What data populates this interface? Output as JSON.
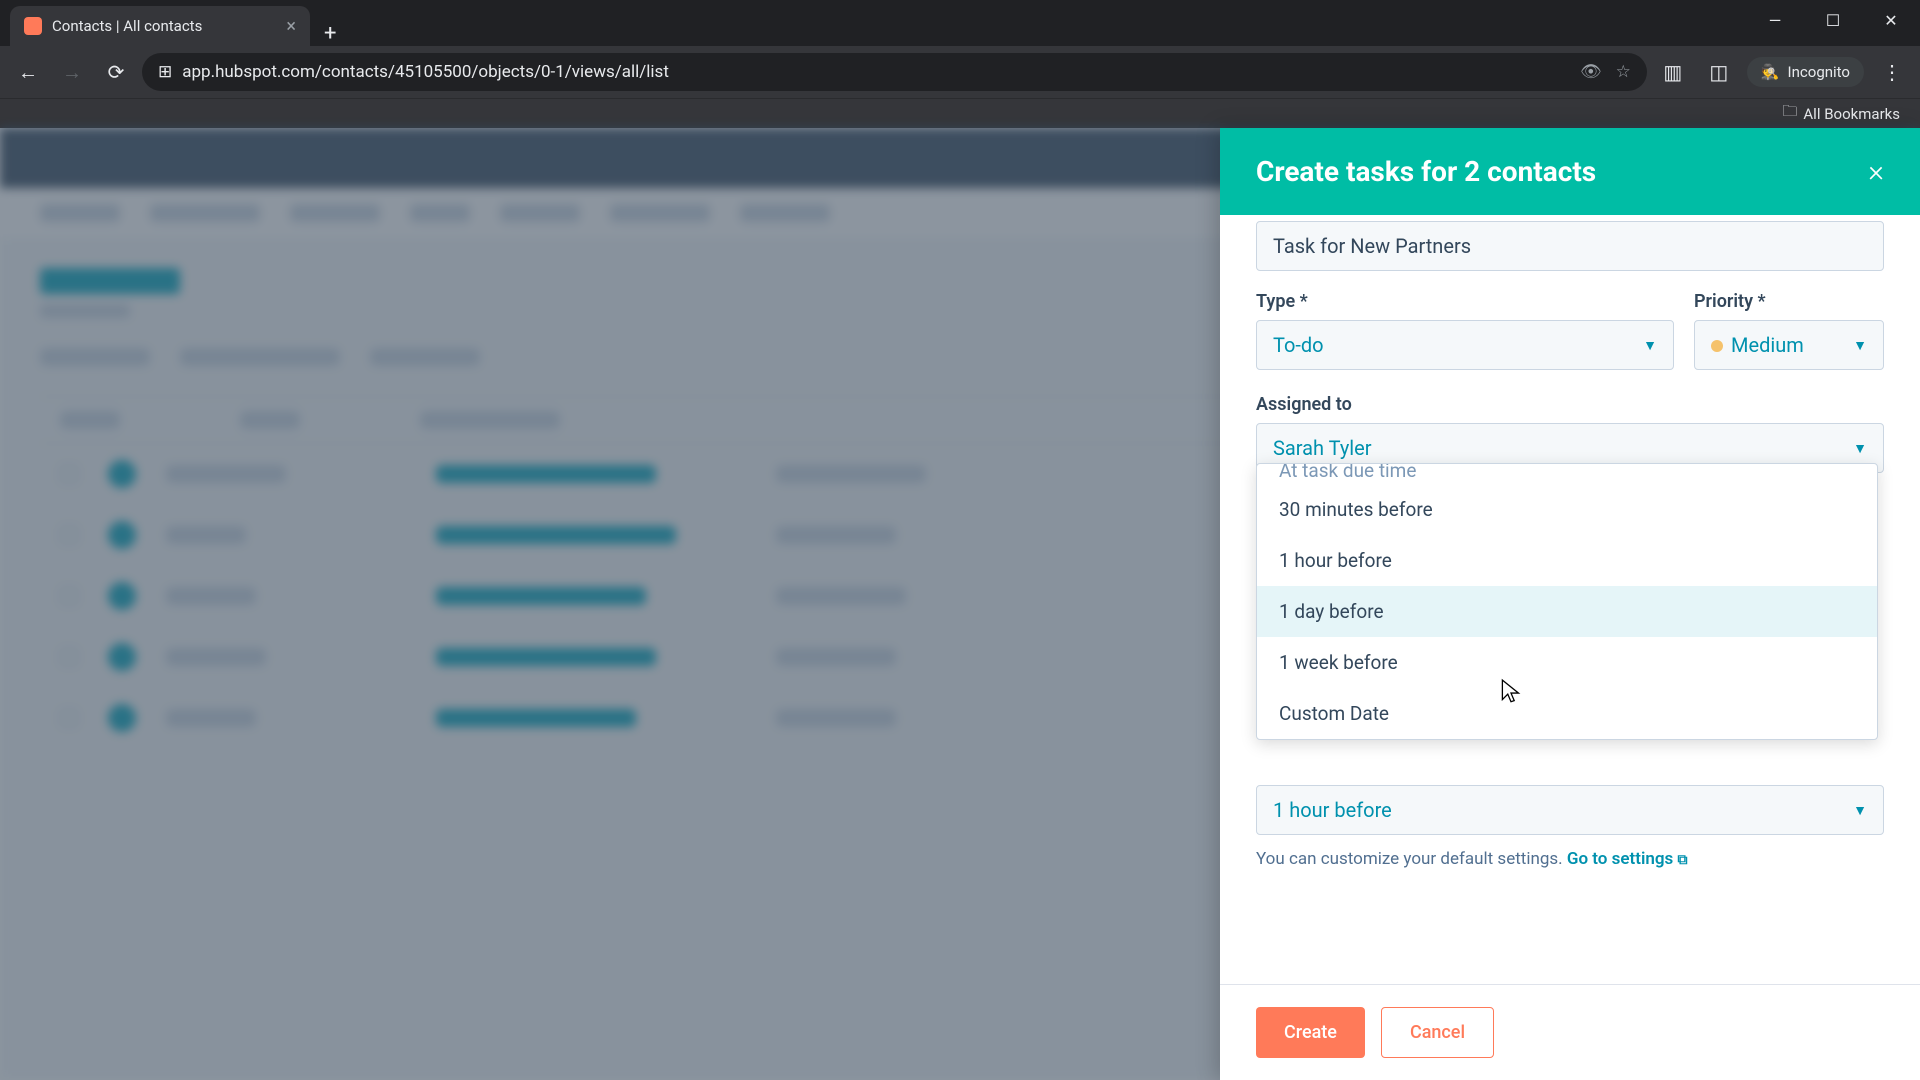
{
  "browser": {
    "tab_title": "Contacts | All contacts",
    "url": "app.hubspot.com/contacts/45105500/objects/0-1/views/all/list",
    "incognito_label": "Incognito",
    "all_bookmarks": "All Bookmarks"
  },
  "panel": {
    "title": "Create tasks for 2 contacts",
    "task_name_value": "Task for New Partners",
    "type_label": "Type *",
    "type_value": "To-do",
    "priority_label": "Priority *",
    "priority_value": "Medium",
    "assigned_to_label": "Assigned to",
    "assigned_to_value": "Sarah Tyler",
    "reminder_value": "1 hour before",
    "settings_hint": "You can customize your default settings. ",
    "settings_link": "Go to settings",
    "create_label": "Create",
    "cancel_label": "Cancel"
  },
  "dropdown": {
    "options": [
      "At task due time",
      "30 minutes before",
      "1 hour before",
      "1 day before",
      "1 week before",
      "Custom Date"
    ],
    "hovered_index": 3
  }
}
